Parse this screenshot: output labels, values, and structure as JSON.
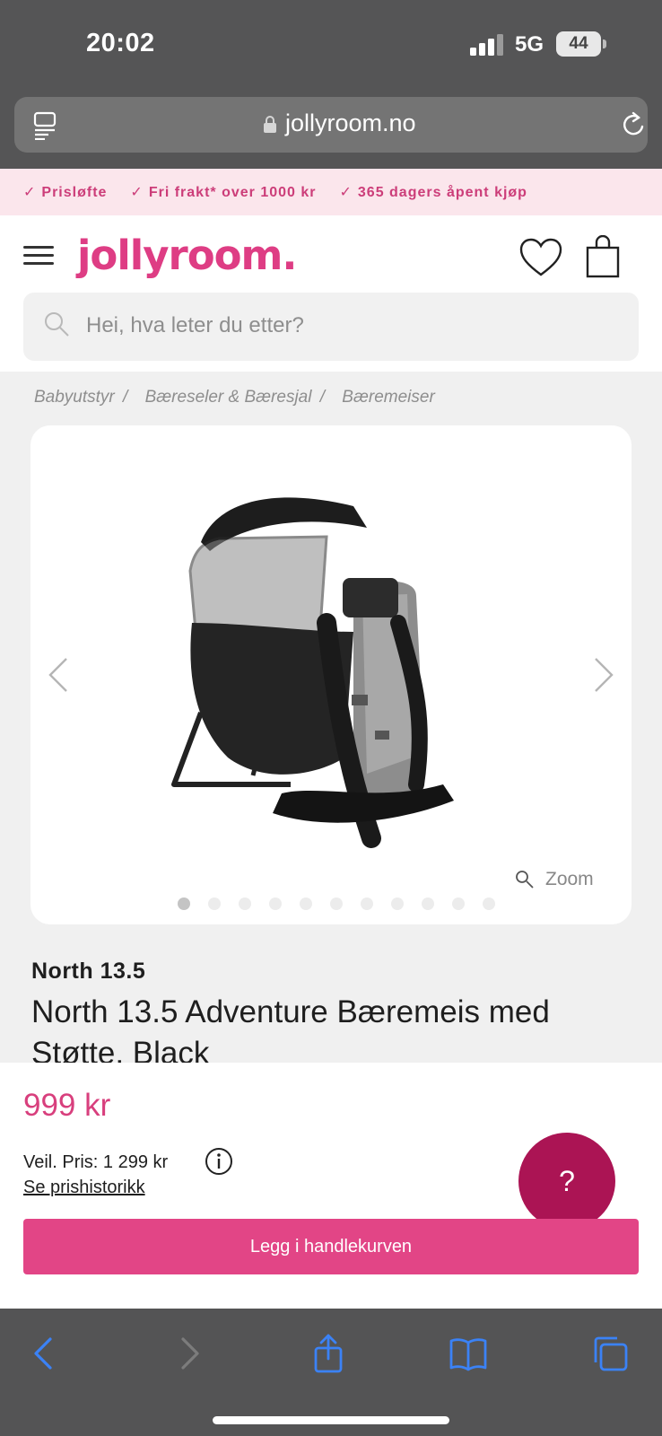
{
  "status_bar": {
    "time": "20:02",
    "network": "5G",
    "battery": "44"
  },
  "browser": {
    "domain": "jollyroom.no"
  },
  "promo": [
    {
      "check": "✓",
      "label": "Prisløfte"
    },
    {
      "check": "✓",
      "label": "Fri frakt* over 1000 kr"
    },
    {
      "check": "✓",
      "label": "365 dagers åpent kjøp"
    }
  ],
  "header": {
    "logo": "jollyroom."
  },
  "search": {
    "placeholder": "Hei, hva leter du etter?"
  },
  "breadcrumb": [
    {
      "label": "Babyutstyr",
      "sep": "/"
    },
    {
      "label": "Bæreseler & Bæresjal",
      "sep": "/"
    },
    {
      "label": "Bæremeiser",
      "sep": ""
    }
  ],
  "gallery": {
    "zoom_label": "Zoom",
    "image_count": 11,
    "active_index": 0
  },
  "product": {
    "brand": "North 13.5",
    "title": "North 13.5 Adventure Bæremeis med Støtte, Black"
  },
  "buy": {
    "price": "999 kr",
    "rrp": "Veil. Pris: 1 299 kr",
    "history_link": "Se prishistorikk",
    "help": "?",
    "cart_button": "Legg i handlekurven"
  },
  "colors": {
    "brand_pink": "#de3d84",
    "help_magenta": "#ab1454",
    "promo_bg": "#fbe6ec",
    "toolbar_blue": "#3b82f6"
  }
}
